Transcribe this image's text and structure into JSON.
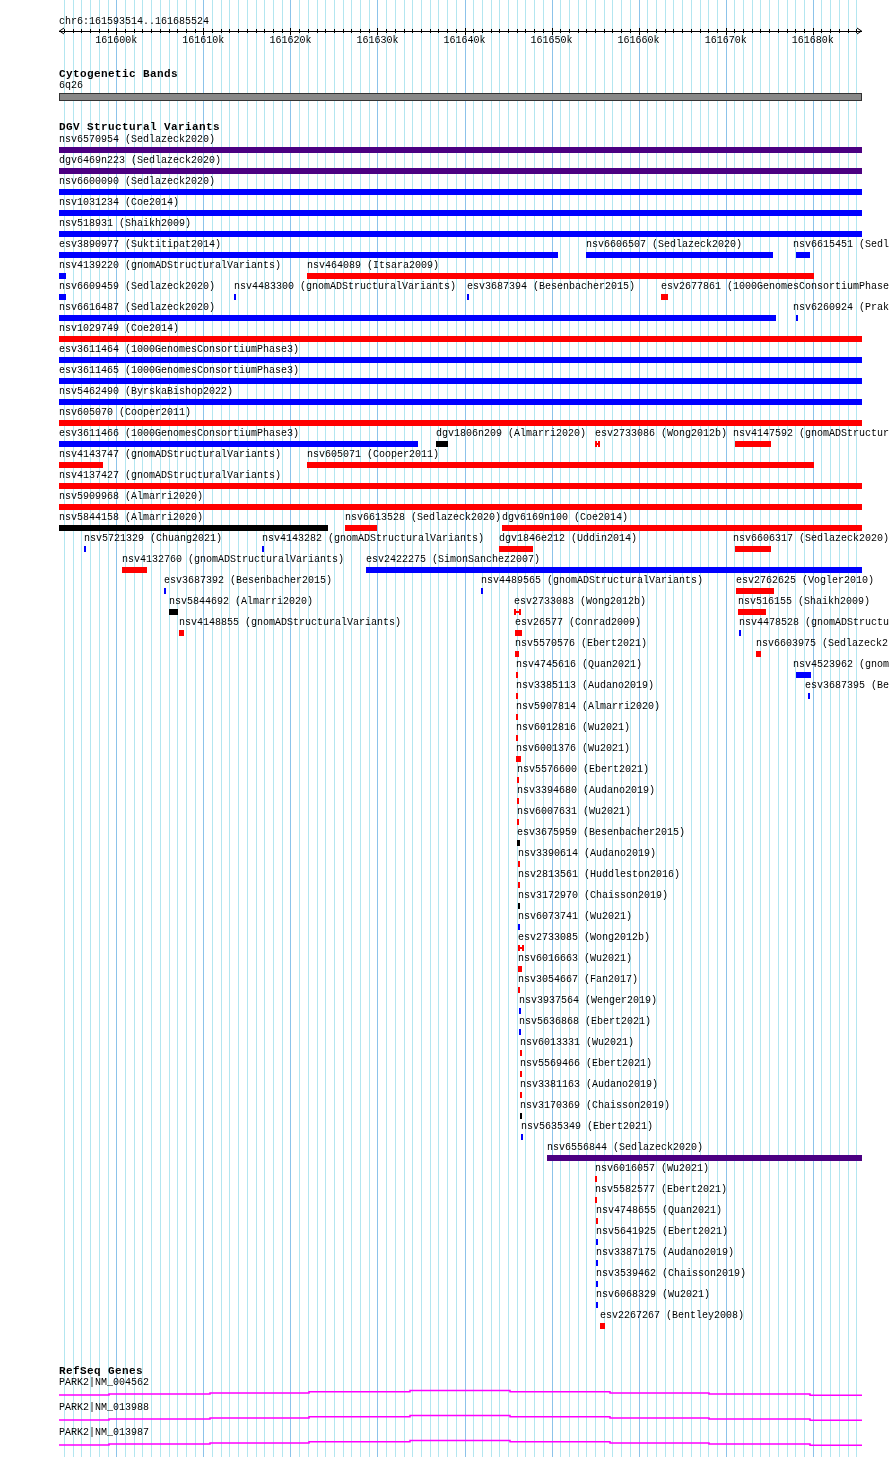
{
  "ruler": {
    "location": "chr6:161593514..161685524",
    "ticks": [
      "161600k",
      "161610k",
      "161620k",
      "161630k",
      "161640k",
      "161650k",
      "161660k",
      "161670k",
      "161680k"
    ]
  },
  "tracks": [
    {
      "kind": "cytoband",
      "title": "Cytogenetic Bands",
      "bands": [
        {
          "label": "6q26"
        }
      ]
    },
    {
      "kind": "variants",
      "title": "DGV Structural Variants",
      "rows": [
        [
          {
            "label": "nsv6570954 (Sedlazeck2020)",
            "color": "#4b0082",
            "kind": "block"
          }
        ],
        [
          {
            "label": "dgv6469n223 (Sedlazeck2020)",
            "color": "#4b0082",
            "kind": "block"
          }
        ],
        [
          {
            "label": "nsv6600090 (Sedlazeck2020)",
            "color": "#0000ff",
            "kind": "block"
          }
        ],
        [
          {
            "label": "nsv1031234 (Coe2014)",
            "color": "#0000ff",
            "kind": "block"
          }
        ],
        [
          {
            "label": "nsv518931 (Shaikh2009)",
            "color": "#0000ff",
            "kind": "block"
          }
        ],
        [
          {
            "label": "esv3890977 (Suktitipat2014)",
            "color": "#0000ff",
            "kind": "block"
          },
          {
            "label": "nsv6606507 (Sedlazeck2020)",
            "color": "#0000ff",
            "kind": "block"
          },
          {
            "label": "nsv6615451 (Sedl",
            "color": "#0000ff",
            "kind": "block"
          }
        ],
        [
          {
            "label": "nsv4139220 (gnomADStructuralVariants)",
            "color": "#0000ff",
            "kind": "block"
          },
          {
            "label": "nsv464089 (Itsara2009)",
            "color": "#ff0000",
            "kind": "block"
          }
        ],
        [
          {
            "label": "nsv6609459 (Sedlazeck2020)",
            "color": "#0000ff",
            "kind": "block"
          },
          {
            "label": "nsv4483300 (gnomADStructuralVariants)",
            "color": "#0000ff",
            "kind": "block"
          },
          {
            "label": "esv3687394 (Besenbacher2015)",
            "color": "#0000ff",
            "kind": "block"
          },
          {
            "label": "esv2677861 (1000GenomesConsortiumPhase",
            "color": "#ff0000",
            "kind": "block"
          }
        ],
        [
          {
            "label": "nsv6616487 (Sedlazeck2020)",
            "color": "#0000ff",
            "kind": "block"
          },
          {
            "label": "nsv6260924 (Prak",
            "color": "#0000ff",
            "kind": "block"
          }
        ],
        [
          {
            "label": "nsv1029749 (Coe2014)",
            "color": "#ff0000",
            "kind": "block"
          }
        ],
        [
          {
            "label": "esv3611464 (1000GenomesConsortiumPhase3)",
            "color": "#0000ff",
            "kind": "block"
          }
        ],
        [
          {
            "label": "esv3611465 (1000GenomesConsortiumPhase3)",
            "color": "#0000ff",
            "kind": "block"
          }
        ],
        [
          {
            "label": "nsv5462490 (ByrskaBishop2022)",
            "color": "#0000ff",
            "kind": "block"
          }
        ],
        [
          {
            "label": "nsv605070 (Cooper2011)",
            "color": "#ff0000",
            "kind": "block"
          }
        ],
        [
          {
            "label": "esv3611466 (1000GenomesConsortiumPhase3)",
            "color": "#0000ff",
            "kind": "block"
          },
          {
            "label": "dgv1806n209 (Almarri2020)",
            "color": "#000000",
            "kind": "block"
          },
          {
            "label": "esv2733086 (Wong2012b)",
            "color": "#ff0000",
            "kind": "pair"
          },
          {
            "label": "nsv4147592 (gnomADStructur",
            "color": "#ff0000",
            "kind": "block"
          }
        ],
        [
          {
            "label": "nsv4143747 (gnomADStructuralVariants)",
            "color": "#ff0000",
            "kind": "block"
          },
          {
            "label": "nsv605071 (Cooper2011)",
            "color": "#ff0000",
            "kind": "block"
          }
        ],
        [
          {
            "label": "nsv4137427 (gnomADStructuralVariants)",
            "color": "#ff0000",
            "kind": "block"
          }
        ],
        [
          {
            "label": "nsv5909968 (Almarri2020)",
            "color": "#ff0000",
            "kind": "block"
          }
        ],
        [
          {
            "label": "nsv5844158 (Almarri2020)",
            "color": "#000000",
            "kind": "block"
          },
          {
            "label": "nsv6613528 (Sedlazeck2020)",
            "color": "#ff0000",
            "kind": "block"
          },
          {
            "label": "dgv6169n100 (Coe2014)",
            "color": "#ff0000",
            "kind": "block"
          }
        ],
        [
          {
            "label": "nsv5721329 (Chuang2021)",
            "color": "#0000ff",
            "kind": "block"
          },
          {
            "label": "nsv4143282 (gnomADStructuralVariants)",
            "color": "#0000ff",
            "kind": "block"
          },
          {
            "label": "dgv1846e212 (Uddin2014)",
            "color": "#ff0000",
            "kind": "block"
          },
          {
            "label": "nsv6606317 (Sedlazeck2020)",
            "color": "#ff0000",
            "kind": "block"
          }
        ],
        [
          {
            "label": "nsv4132760 (gnomADStructuralVariants)",
            "color": "#ff0000",
            "kind": "block"
          },
          {
            "label": "esv2422275 (SimonSanchez2007)",
            "color": "#0000ff",
            "kind": "block"
          }
        ],
        [
          {
            "label": "esv3687392 (Besenbacher2015)",
            "color": "#0000ff",
            "kind": "block"
          },
          {
            "label": "nsv4489565 (gnomADStructuralVariants)",
            "color": "#0000ff",
            "kind": "block"
          },
          {
            "label": "esv2762625 (Vogler2010)",
            "color": "#ff0000",
            "kind": "block"
          }
        ],
        [
          {
            "label": "nsv5844692 (Almarri2020)",
            "color": "#000000",
            "kind": "block"
          },
          {
            "label": "esv2733083 (Wong2012b)",
            "color": "#ff0000",
            "kind": "pair"
          },
          {
            "label": "nsv516155 (Shaikh2009)",
            "color": "#ff0000",
            "kind": "block"
          }
        ],
        [
          {
            "label": "nsv4148855 (gnomADStructuralVariants)",
            "color": "#ff0000",
            "kind": "block"
          },
          {
            "label": "esv26577 (Conrad2009)",
            "color": "#ff0000",
            "kind": "block"
          },
          {
            "label": "nsv4478528 (gnomADStructu",
            "color": "#0000ff",
            "kind": "block"
          }
        ],
        [
          {
            "label": "nsv5570576 (Ebert2021)",
            "color": "#ff0000",
            "kind": "block"
          },
          {
            "label": "nsv6603975 (Sedlazeck2",
            "color": "#ff0000",
            "kind": "block"
          }
        ],
        [
          {
            "label": "nsv4745616 (Quan2021)",
            "color": "#ff0000",
            "kind": "block"
          },
          {
            "label": "nsv4523962 (gnom",
            "color": "#0000ff",
            "kind": "block"
          }
        ],
        [
          {
            "label": "nsv3385113 (Audano2019)",
            "color": "#ff0000",
            "kind": "block"
          },
          {
            "label": "esv3687395 (Be",
            "color": "#0000ff",
            "kind": "block"
          }
        ],
        [
          {
            "label": "nsv5907814 (Almarri2020)",
            "color": "#ff0000",
            "kind": "block"
          }
        ],
        [
          {
            "label": "nsv6012816 (Wu2021)",
            "color": "#ff0000",
            "kind": "block"
          }
        ],
        [
          {
            "label": "nsv6001376 (Wu2021)",
            "color": "#ff0000",
            "kind": "block"
          }
        ],
        [
          {
            "label": "nsv5576600 (Ebert2021)",
            "color": "#ff0000",
            "kind": "block"
          }
        ],
        [
          {
            "label": "nsv3394680 (Audano2019)",
            "color": "#ff0000",
            "kind": "block"
          }
        ],
        [
          {
            "label": "nsv6007631 (Wu2021)",
            "color": "#ff0000",
            "kind": "block"
          }
        ],
        [
          {
            "label": "esv3675959 (Besenbacher2015)",
            "color": "#000000",
            "kind": "block"
          }
        ],
        [
          {
            "label": "nsv3390614 (Audano2019)",
            "color": "#ff0000",
            "kind": "block"
          }
        ],
        [
          {
            "label": "nsv2813561 (Huddleston2016)",
            "color": "#ff0000",
            "kind": "block"
          }
        ],
        [
          {
            "label": "nsv3172970 (Chaisson2019)",
            "color": "#000000",
            "kind": "block"
          }
        ],
        [
          {
            "label": "nsv6073741 (Wu2021)",
            "color": "#0000ff",
            "kind": "block"
          }
        ],
        [
          {
            "label": "esv2733085 (Wong2012b)",
            "color": "#ff0000",
            "kind": "pair"
          }
        ],
        [
          {
            "label": "nsv6016663 (Wu2021)",
            "color": "#ff0000",
            "kind": "block"
          }
        ],
        [
          {
            "label": "nsv3054667 (Fan2017)",
            "color": "#ff0000",
            "kind": "block"
          }
        ],
        [
          {
            "label": "nsv3937564 (Wenger2019)",
            "color": "#0000ff",
            "kind": "block"
          }
        ],
        [
          {
            "label": "nsv5636868 (Ebert2021)",
            "color": "#0000ff",
            "kind": "block"
          }
        ],
        [
          {
            "label": "nsv6013331 (Wu2021)",
            "color": "#ff0000",
            "kind": "block"
          }
        ],
        [
          {
            "label": "nsv5569466 (Ebert2021)",
            "color": "#ff0000",
            "kind": "block"
          }
        ],
        [
          {
            "label": "nsv3381163 (Audano2019)",
            "color": "#ff0000",
            "kind": "block"
          }
        ],
        [
          {
            "label": "nsv3170369 (Chaisson2019)",
            "color": "#000000",
            "kind": "block"
          }
        ],
        [
          {
            "label": "nsv5635349 (Ebert2021)",
            "color": "#0000ff",
            "kind": "block"
          }
        ],
        [
          {
            "label": "nsv6556844 (Sedlazeck2020)",
            "color": "#4b0082",
            "kind": "block"
          }
        ],
        [
          {
            "label": "nsv6016057 (Wu2021)",
            "color": "#ff0000",
            "kind": "block"
          }
        ],
        [
          {
            "label": "nsv5582577 (Ebert2021)",
            "color": "#ff0000",
            "kind": "block"
          }
        ],
        [
          {
            "label": "nsv4748655 (Quan2021)",
            "color": "#ff0000",
            "kind": "block"
          }
        ],
        [
          {
            "label": "nsv5641925 (Ebert2021)",
            "color": "#0000ff",
            "kind": "block"
          }
        ],
        [
          {
            "label": "nsv3387175 (Audano2019)",
            "color": "#0000ff",
            "kind": "block"
          }
        ],
        [
          {
            "label": "nsv3539462 (Chaisson2019)",
            "color": "#0000ff",
            "kind": "block"
          }
        ],
        [
          {
            "label": "nsv6068329 (Wu2021)",
            "color": "#0000ff",
            "kind": "block"
          }
        ],
        [
          {
            "label": "esv2267267 (Bentley2008)",
            "color": "#ff0000",
            "kind": "block"
          }
        ]
      ]
    },
    {
      "kind": "genes",
      "title": "RefSeq Genes",
      "transcripts": [
        {
          "label": "PARK2|NM_004562"
        },
        {
          "label": "PARK2|NM_013988"
        },
        {
          "label": "PARK2|NM_013987"
        }
      ]
    }
  ]
}
